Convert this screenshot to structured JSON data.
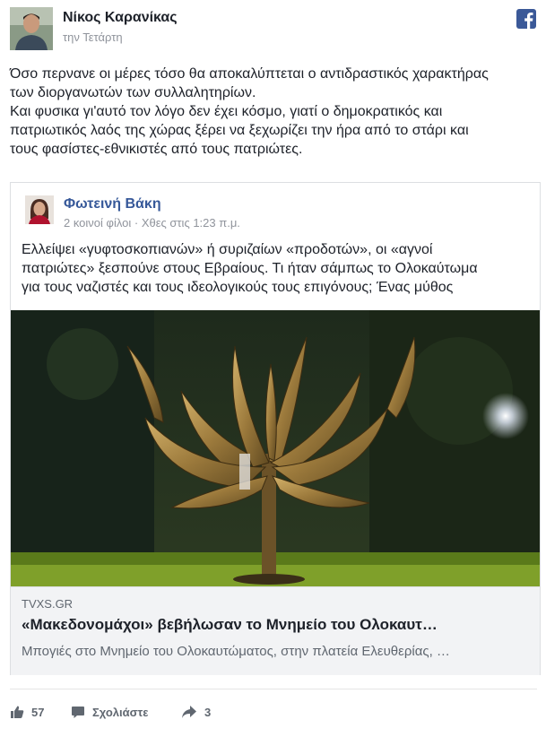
{
  "post": {
    "author": "Νίκος Καρανίκας",
    "time": "την Τετάρτη",
    "text_lines": [
      "Όσο περνανε οι μέρες τόσο θα αποκαλύπτεται ο αντιδραστικός χαρακτήρας",
      "των διοργανωτών των συλλαλητηρίων.",
      "Και φυσικα γι'αυτό τον λόγο δεν έχει κόσμο, γιατί ο δημοκρατικός και",
      "πατριωτικός λαός της χώρας ξέρει να ξεχωρίζει την ήρα από το στάρι και",
      "τους φασίστες-εθνικιστές από τους πατριώτες."
    ]
  },
  "shared": {
    "author": "Φωτεινή Βάκη",
    "meta": "2 κοινοί φίλοι · Χθες στις 1:23 π.μ.",
    "text_lines": [
      "Ελλείψει «γυφτοσκοπιανών» ή συριζαίων «προδοτών», οι «αγνοί",
      "πατριώτες» ξεσπούνε στους Εβραίους. Τι ήταν σάμπως το Ολοκαύτωμα",
      "για τους ναζιστές και τους ιδεολογικούς τους επιγόνους; Ένας μύθος"
    ],
    "link": {
      "domain": "TVXS.GR",
      "title": "«Μακεδονομάχοι» βεβήλωσαν το Μνημείο του Ολοκαυτ…",
      "description": "Μπογιές στο Μνημείο του Ολοκαυτώματος, στην πλατεία Ελευθερίας, …"
    }
  },
  "actions": {
    "likes": "57",
    "comment_label": "Σχολιάστε",
    "shares": "3"
  },
  "colors": {
    "link_blue": "#365899",
    "facebook_blue": "#3b5998",
    "meta_gray": "#90949c",
    "action_gray": "#606770"
  },
  "icons": [
    "facebook-logo-icon",
    "like-icon",
    "comment-icon",
    "share-icon"
  ]
}
